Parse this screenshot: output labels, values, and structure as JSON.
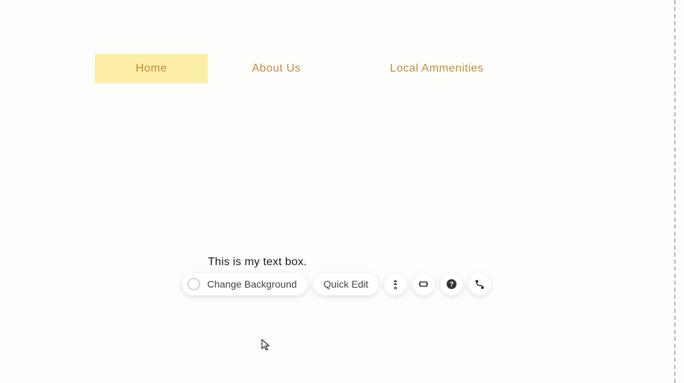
{
  "nav": {
    "items": [
      {
        "label": "Home",
        "active": true
      },
      {
        "label": "About Us",
        "active": false
      },
      {
        "label": "Local Ammenities",
        "active": false
      }
    ]
  },
  "textbox": {
    "content": "This is my text box."
  },
  "toolbar": {
    "change_background_label": "Change Background",
    "quick_edit_label": "Quick Edit",
    "icons": {
      "scroll": "scroll-icon",
      "stretch": "stretch-icon",
      "help": "help-icon",
      "animation": "animation-icon"
    }
  }
}
